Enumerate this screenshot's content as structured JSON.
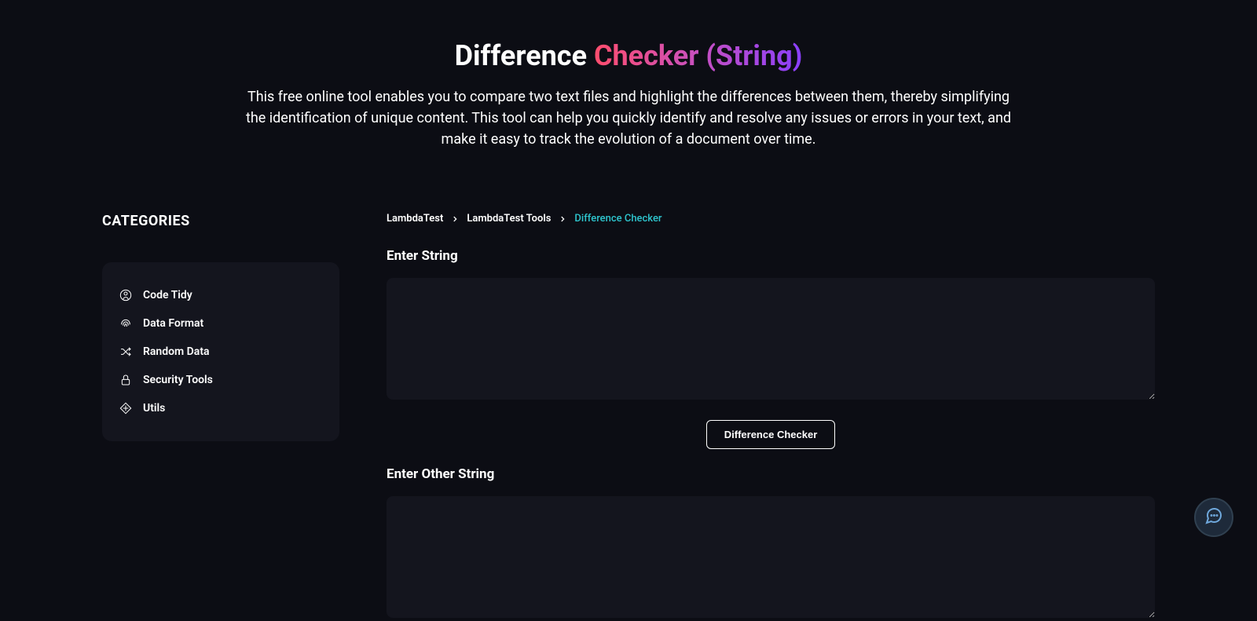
{
  "hero": {
    "title_part1": "Difference ",
    "title_part2": "Checker (String)",
    "description": "This free online tool enables you to compare two text files and highlight the differences between them, thereby simplifying the identification of unique content. This tool can help you quickly identify and resolve any issues or errors in your text, and make it easy to track the evolution of a document over time."
  },
  "sidebar": {
    "title": "CATEGORIES",
    "items": [
      {
        "label": "Code Tidy",
        "icon": "code-tidy"
      },
      {
        "label": "Data Format",
        "icon": "data-format"
      },
      {
        "label": "Random Data",
        "icon": "random-data"
      },
      {
        "label": "Security Tools",
        "icon": "security-tools"
      },
      {
        "label": "Utils",
        "icon": "utils"
      }
    ]
  },
  "breadcrumb": {
    "items": [
      {
        "label": "LambdaTest",
        "type": "link"
      },
      {
        "label": "LambdaTest Tools",
        "type": "link"
      },
      {
        "label": "Difference Checker",
        "type": "current"
      }
    ]
  },
  "form": {
    "label1": "Enter String",
    "label2": "Enter Other String",
    "button_label": "Difference Checker"
  }
}
